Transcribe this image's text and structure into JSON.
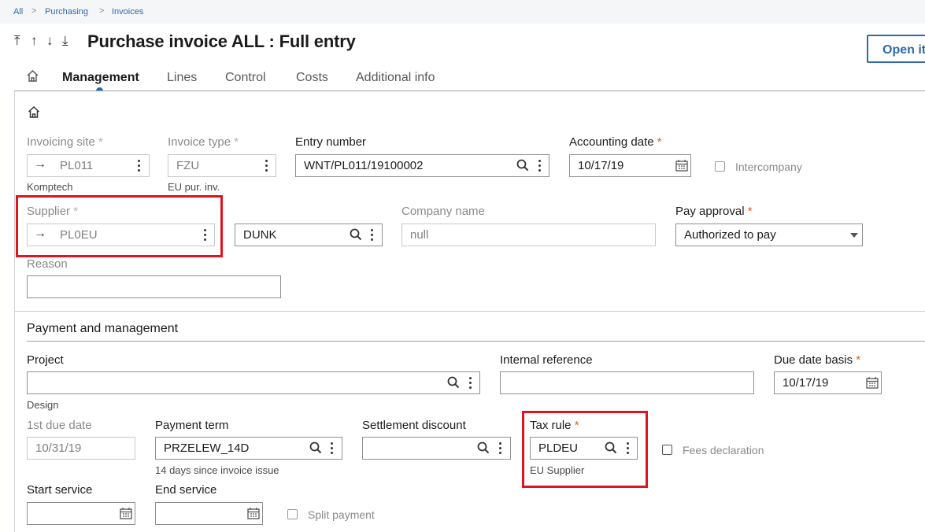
{
  "breadcrumb": {
    "items": [
      "All",
      "Purchasing",
      "Invoices"
    ]
  },
  "nav_arrows": [
    "⤒",
    "↑",
    "↓",
    "⤓"
  ],
  "page": {
    "title": "Purchase invoice ALL : Full entry",
    "open_button": "Open it"
  },
  "tabs": [
    "Management",
    "Lines",
    "Control",
    "Costs",
    "Additional info"
  ],
  "active_tab": "Management",
  "header_fields": {
    "invoicing_site": {
      "label": "Invoicing site",
      "value": "PL011",
      "description": "Komptech",
      "required": true
    },
    "invoice_type": {
      "label": "Invoice type",
      "value": "FZU",
      "description": "EU pur. inv.",
      "required": true
    },
    "entry_number": {
      "label": "Entry number",
      "value": "WNT/PL011/19100002"
    },
    "accounting_date": {
      "label": "Accounting date",
      "value": "10/17/19",
      "required": true
    },
    "intercompany": {
      "label": "Intercompany",
      "checked": false
    },
    "supplier": {
      "label": "Supplier",
      "value": "PL0EU",
      "required": true
    },
    "supplier_code": {
      "value": "DUNK"
    },
    "company_name": {
      "label": "Company name",
      "value": "null"
    },
    "pay_approval": {
      "label": "Pay approval",
      "value": "Authorized to pay",
      "required": true
    },
    "reason": {
      "label": "Reason",
      "value": ""
    }
  },
  "payment_section": {
    "title": "Payment and management",
    "project": {
      "label": "Project",
      "value": "",
      "description": "Design"
    },
    "internal_reference": {
      "label": "Internal reference",
      "value": ""
    },
    "due_date_basis": {
      "label": "Due date basis",
      "value": "10/17/19",
      "required": true
    },
    "first_due_date": {
      "label": "1st due date",
      "value": "10/31/19"
    },
    "payment_term": {
      "label": "Payment term",
      "value": "PRZELEW_14D",
      "description": "14 days since invoice issue"
    },
    "settlement_discount": {
      "label": "Settlement discount",
      "value": ""
    },
    "tax_rule": {
      "label": "Tax rule",
      "value": "PLDEU",
      "description": "EU Supplier",
      "required": true
    },
    "fees_declaration": {
      "label": "Fees declaration",
      "checked": false
    },
    "start_service": {
      "label": "Start service",
      "value": ""
    },
    "end_service": {
      "label": "End service",
      "value": ""
    },
    "split_payment": {
      "label": "Split payment",
      "checked": false
    }
  },
  "required_marker": "*",
  "colors": {
    "accent": "#2f6aa8",
    "required": "#e8591c",
    "highlight": "#e0141e"
  }
}
